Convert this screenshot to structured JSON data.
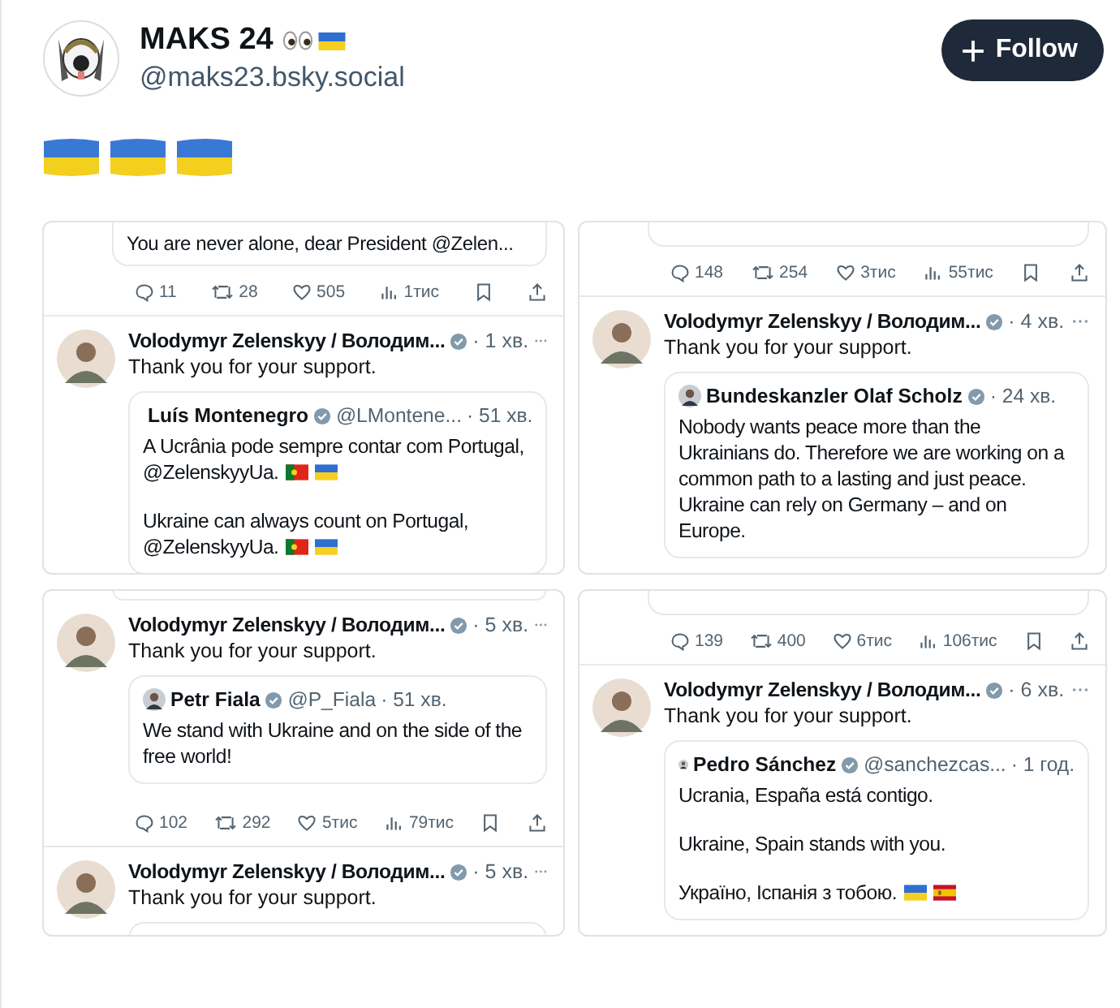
{
  "profile": {
    "name": "MAKS 24",
    "handle": "@maks23.bsky.social",
    "follow_label": "Follow"
  },
  "panels": [
    {
      "items": [
        {
          "kind": "quote_tail",
          "text": "You are never alone, dear President @Zelen..."
        },
        {
          "kind": "stats",
          "reply": "11",
          "repost": "28",
          "like": "505",
          "views": "1тис"
        },
        {
          "kind": "tweet",
          "author": "Volodymyr Zelenskyy / Володим...",
          "verified": true,
          "time": "· 1 хв.",
          "text": "Thank you for your support.",
          "quote": {
            "author": "Luís Montenegro",
            "verified": true,
            "handle": "@LMontene...",
            "time": "· 51 хв.",
            "paragraphs": [
              {
                "lines": [
                  "A Ucrânia pode sempre contar com Portugal,",
                  "@ZelenskyyUa."
                ],
                "flags": [
                  {
                    "kind": "pt"
                  },
                  {
                    "kind": "ua"
                  }
                ]
              },
              {
                "lines": [
                  "Ukraine can always count on Portugal,",
                  "@ZelenskyyUa."
                ],
                "flags": [
                  {
                    "kind": "pt"
                  },
                  {
                    "kind": "ua"
                  }
                ]
              }
            ]
          }
        }
      ]
    },
    {
      "items": [
        {
          "kind": "quote_tail"
        },
        {
          "kind": "stats",
          "reply": "148",
          "repost": "254",
          "like": "3тис",
          "views": "55тис"
        },
        {
          "kind": "tweet",
          "author": "Volodymyr Zelenskyy / Володим...",
          "verified": true,
          "time": "· 4 хв.",
          "text": "Thank you for your support.",
          "quote": {
            "author": "Bundeskanzler Olaf Scholz",
            "verified": true,
            "time": "· 24 хв.",
            "paragraphs": [
              {
                "lines": [
                  "Nobody wants peace more than the Ukrainians do. Therefore we are working on a common path to a lasting and just peace. Ukraine can rely on Germany – and on Europe."
                ]
              }
            ]
          }
        }
      ]
    },
    {
      "items": [
        {
          "kind": "quote_tail"
        },
        {
          "kind": "tweet",
          "author": "Volodymyr Zelenskyy / Володим...",
          "verified": true,
          "time": "· 5 хв.",
          "text": "Thank you for your support.",
          "quote": {
            "author": "Petr Fiala",
            "verified": true,
            "handle": "@P_Fiala",
            "time": "· 51 хв.",
            "paragraphs": [
              {
                "lines": [
                  "We stand with Ukraine and on the side of the free world!"
                ]
              }
            ]
          }
        },
        {
          "kind": "stats",
          "reply": "102",
          "repost": "292",
          "like": "5тис",
          "views": "79тис"
        },
        {
          "kind": "tweet",
          "author": "Volodymyr Zelenskyy / Володим...",
          "verified": true,
          "time": "· 5 хв.",
          "text": "Thank you for your support.",
          "quote_cut": true
        }
      ]
    },
    {
      "items": [
        {
          "kind": "quote_tail"
        },
        {
          "kind": "stats",
          "reply": "139",
          "repost": "400",
          "like": "6тис",
          "views": "106тис"
        },
        {
          "kind": "tweet",
          "author": "Volodymyr Zelenskyy / Володим...",
          "verified": true,
          "time": "· 6 хв.",
          "text": "Thank you for your support.",
          "quote": {
            "author": "Pedro Sánchez",
            "verified": true,
            "handle": "@sanchezcas...",
            "time": "· 1 год.",
            "paragraphs": [
              {
                "lines": [
                  "Ucrania, España está contigo."
                ]
              },
              {
                "lines": [
                  "Ukraine, Spain stands with you."
                ]
              },
              {
                "lines": [
                  "Україно, Іспанія з тобою."
                ],
                "flags": [
                  {
                    "kind": "ua"
                  },
                  {
                    "kind": "es"
                  }
                ]
              }
            ]
          }
        }
      ]
    }
  ]
}
